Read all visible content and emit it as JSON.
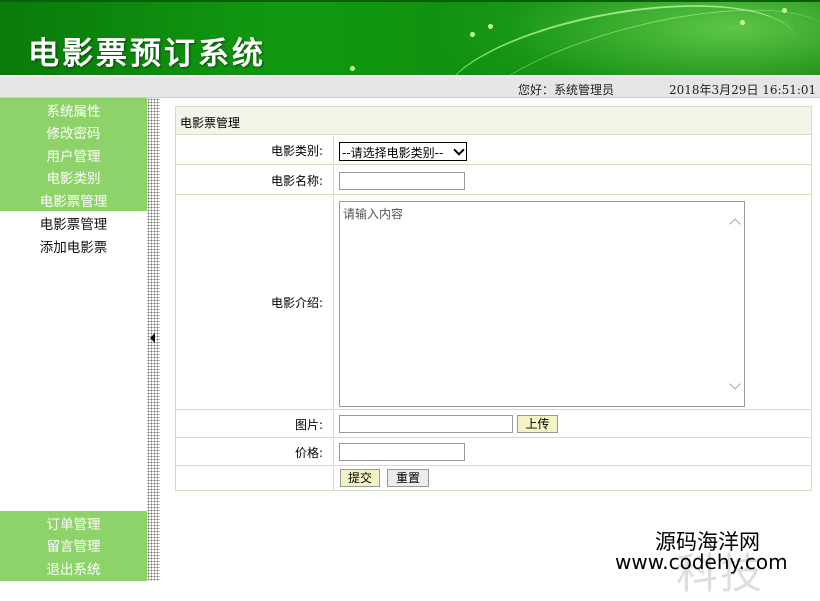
{
  "header": {
    "title": "电影票预订系统"
  },
  "infobar": {
    "greeting": "您好：系统管理员",
    "datetime": "2018年3月29日 16:51:01"
  },
  "sidebar": {
    "top_items": [
      {
        "label": "系统属性"
      },
      {
        "label": "修改密码"
      },
      {
        "label": "用户管理"
      },
      {
        "label": "电影类别"
      },
      {
        "label": "电影票管理"
      }
    ],
    "sub_items": [
      {
        "label": "电影票管理"
      },
      {
        "label": "添加电影票"
      }
    ],
    "bottom_items": [
      {
        "label": "订单管理"
      },
      {
        "label": "留言管理"
      },
      {
        "label": "退出系统"
      }
    ]
  },
  "form": {
    "panel_title": "电影票管理",
    "category_label": "电影类别:",
    "category_selected": "--请选择电影类别--",
    "name_label": "电影名称:",
    "name_value": "",
    "intro_label": "电影介绍:",
    "intro_placeholder": "请输入内容",
    "image_label": "图片:",
    "image_value": "",
    "upload_button": "上传",
    "price_label": "价格:",
    "price_value": "",
    "submit_button": "提交",
    "reset_button": "重置"
  },
  "watermark": {
    "line1": "源码海洋网",
    "line2": "www.codehy.com",
    "faded": "科技"
  },
  "colors": {
    "header_green": "#119a11",
    "menu_green": "#8ed36a",
    "border": "#d6ddc0",
    "panel_head": "#f2f5e8",
    "button_yellow": "#f3f3c6"
  }
}
